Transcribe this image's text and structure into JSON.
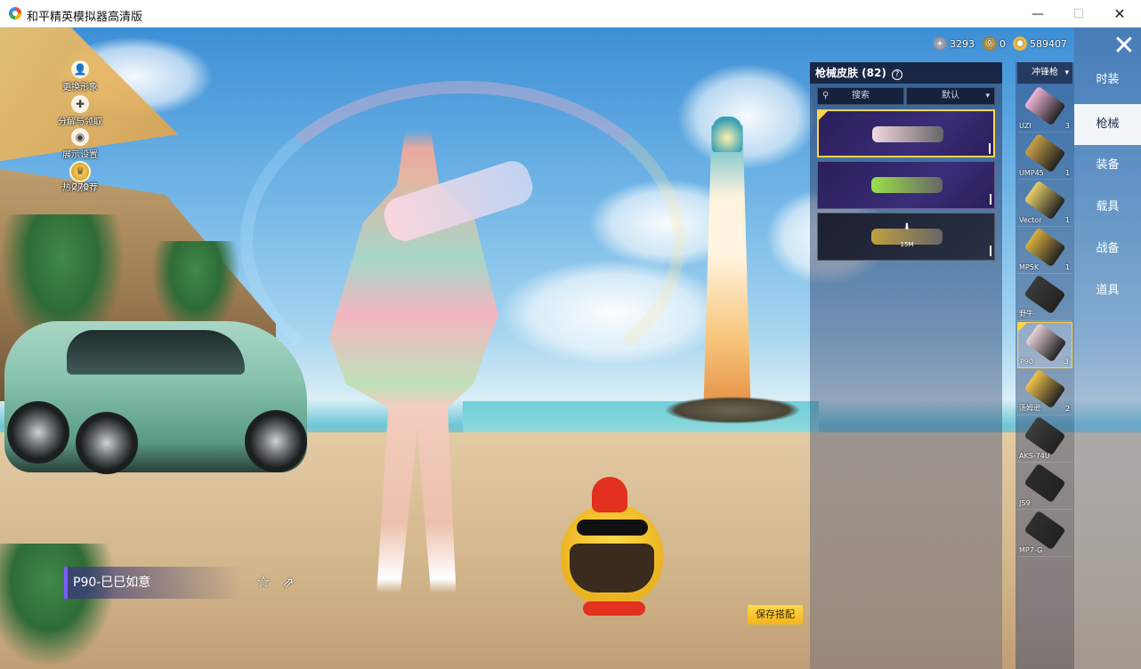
{
  "window": {
    "title": "和平精英模拟器高清版",
    "min_glyph": "—",
    "max_glyph": "☐",
    "close_glyph": "✕"
  },
  "left_hud": {
    "items": [
      {
        "label": "更换形象",
        "icon": "person-icon",
        "glyph": "👤"
      },
      {
        "label": "分解与领取",
        "icon": "decompose-icon",
        "glyph": "✚"
      },
      {
        "label": "展示设置",
        "icon": "eye-icon",
        "glyph": "◉"
      },
      {
        "label": "热门推荐",
        "icon": "fire-icon",
        "glyph": "♨"
      }
    ],
    "level": "270",
    "level_glyph": "♛"
  },
  "currency": {
    "silver": "3293",
    "voucher": "0",
    "gold": "589407",
    "silver_glyph": "◈",
    "voucher_glyph": "⓪",
    "gold_glyph": "●"
  },
  "close_glyph": "✕",
  "categories": [
    {
      "label": "时装",
      "active": false
    },
    {
      "label": "枪械",
      "active": true
    },
    {
      "label": "装备",
      "active": false
    },
    {
      "label": "载具",
      "active": false
    },
    {
      "label": "战备",
      "active": false
    },
    {
      "label": "道具",
      "active": false
    }
  ],
  "gun_filter": {
    "label": "冲锋枪",
    "chevron": "▾"
  },
  "guns": [
    {
      "name": "UZI",
      "count": "3",
      "color": "#f2b6d8",
      "selected": false
    },
    {
      "name": "UMP45",
      "count": "1",
      "color": "#c9a047",
      "selected": false
    },
    {
      "name": "Vector",
      "count": "1",
      "color": "#e7d06a",
      "selected": false
    },
    {
      "name": "MP5K",
      "count": "1",
      "color": "#d9b040",
      "selected": false
    },
    {
      "name": "野牛",
      "count": "",
      "color": "#3b3b3b",
      "selected": false
    },
    {
      "name": "P90",
      "count": "3",
      "color": "#e9d2dc",
      "selected": true
    },
    {
      "name": "汤姆逊",
      "count": "2",
      "color": "#f0c24a",
      "selected": false
    },
    {
      "name": "AKS-74U",
      "count": "",
      "color": "#3d3d3d",
      "selected": false
    },
    {
      "name": "JS9",
      "count": "",
      "color": "#2b2b2b",
      "selected": false
    },
    {
      "name": "MP7-G",
      "count": "",
      "color": "#2f2f2f",
      "selected": false
    }
  ],
  "skin_panel": {
    "title": "枪械皮肤 (82)",
    "help_glyph": "?",
    "search_placeholder": "搜索",
    "search_glyph": "⚲",
    "sort_label": "默认",
    "sort_chevron": "▾",
    "skins": [
      {
        "selected": true,
        "style": "purple",
        "gun_color": "#f3d7e1",
        "download": false
      },
      {
        "selected": false,
        "style": "purple",
        "gun_color": "#9be04a",
        "download": false
      },
      {
        "selected": false,
        "style": "dark",
        "gun_color": "#c0a040",
        "download": true,
        "download_glyph": "⬇",
        "download_size": "15M"
      }
    ]
  },
  "current_skin_name": "P90-巳巳如意",
  "fav_glyph": "☆",
  "share_glyph": "⇗",
  "save_button": "保存搭配"
}
